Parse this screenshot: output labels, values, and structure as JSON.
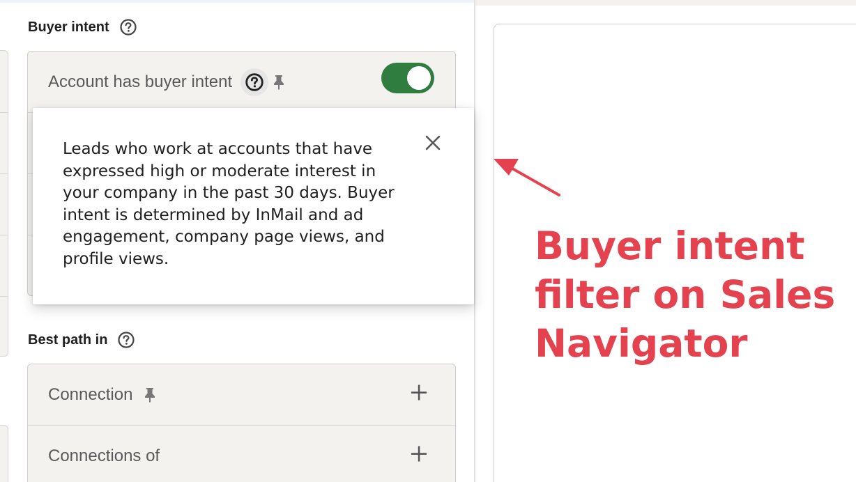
{
  "buyer_intent_section": {
    "heading": "Buyer intent",
    "help_icon": "question-circle-icon",
    "row": {
      "label": "Account has buyer intent",
      "help_icon": "question-circle-icon",
      "pin_icon": "pin-icon",
      "toggle_on": true,
      "toggle_color": "#2f7d3f"
    }
  },
  "tooltip": {
    "text": "Leads who work at accounts that have expressed high or moderate interest in your company in the past 30 days. Buyer intent is determined by InMail and ad engagement, company page views, and profile views.",
    "close_icon": "close-icon"
  },
  "best_path_section": {
    "heading": "Best path in",
    "help_icon": "question-circle-icon",
    "rows": [
      {
        "label": "Connection",
        "pin_icon": "pin-icon",
        "action_icon": "plus-icon"
      },
      {
        "label": "Connections of",
        "action_icon": "plus-icon"
      }
    ]
  },
  "annotation": {
    "text": "Buyer intent filter on Sales Navigator",
    "color": "#e5424f"
  }
}
